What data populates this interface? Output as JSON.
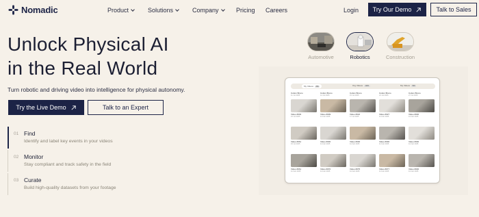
{
  "brand": {
    "name": "Nomadic",
    "color": "#1c2346"
  },
  "nav": {
    "items": [
      {
        "label": "Product",
        "dropdown": true
      },
      {
        "label": "Solutions",
        "dropdown": true
      },
      {
        "label": "Company",
        "dropdown": true
      },
      {
        "label": "Pricing",
        "dropdown": false
      },
      {
        "label": "Careers",
        "dropdown": false
      }
    ],
    "login": "Login",
    "demo": "Try Our Demo",
    "sales": "Talk to Sales"
  },
  "hero": {
    "line1": "Unlock Physical AI",
    "line2": "in the Real World",
    "subhead": "Turn robotic and driving video into intelligence for physical autonomy.",
    "primary_cta": "Try the Live Demo",
    "secondary_cta": "Talk to an Expert"
  },
  "features": [
    {
      "num": "01",
      "title": "Find",
      "desc": "Identify and label key events in your videos",
      "active": true
    },
    {
      "num": "02",
      "title": "Monitor",
      "desc": "Stay compliant and track safety in the field",
      "active": false
    },
    {
      "num": "03",
      "title": "Curate",
      "desc": "Build high-quality datasets from your footage",
      "active": false
    }
  ],
  "categories": [
    {
      "label": "Automotive",
      "selected": false
    },
    {
      "label": "Robotics",
      "selected": true
    },
    {
      "label": "Construction",
      "selected": false
    }
  ],
  "preview": {
    "tabs": [
      {
        "label": "My Videos",
        "badge": "350"
      },
      {
        "label": "Org Videos",
        "badge": "1200"
      },
      {
        "label": "My Videos",
        "badge": "500"
      }
    ],
    "header_row": [
      {
        "title": "Cotton Bruno",
        "date": "11 Jul 2025"
      },
      {
        "title": "Cotton Bruno",
        "date": "14 Jul 2025"
      },
      {
        "title": "Cotton Bruno",
        "date": "15 Jul 2025"
      },
      {
        "title": "Cotton Bruno",
        "date": "21 Jul 2025"
      },
      {
        "title": "Cotton Bruno",
        "date": "27 Jul 2025"
      }
    ],
    "rows": [
      [
        {
          "title": "Video #003",
          "date": "15 Jul 2025"
        },
        {
          "title": "Video #009",
          "date": "11 Feb 2025"
        },
        {
          "title": "Video #016",
          "date": "17 Jul 2025"
        },
        {
          "title": "Video #027",
          "date": "11 Feb 2025"
        },
        {
          "title": "Video #030",
          "date": "11 Feb 2025"
        }
      ],
      [
        {
          "title": "Video #061",
          "date": "15 Jul 2025"
        },
        {
          "title": "Video #030",
          "date": "11 Feb 2025"
        },
        {
          "title": "Video #030",
          "date": "11 Feb 2025"
        },
        {
          "title": "Video #030",
          "date": "11 Feb 2025"
        },
        {
          "title": "Video #030",
          "date": "11 Feb 2025"
        }
      ],
      [
        {
          "title": "Video #061",
          "date": "11 Feb 2025"
        },
        {
          "title": "Video #070",
          "date": "11 Feb 2025"
        },
        {
          "title": "Video #075",
          "date": "11 Feb 2025"
        },
        {
          "title": "Video #077",
          "date": "11 Feb 2025"
        },
        {
          "title": "Video #030",
          "date": "11 Feb 2025"
        }
      ]
    ]
  }
}
